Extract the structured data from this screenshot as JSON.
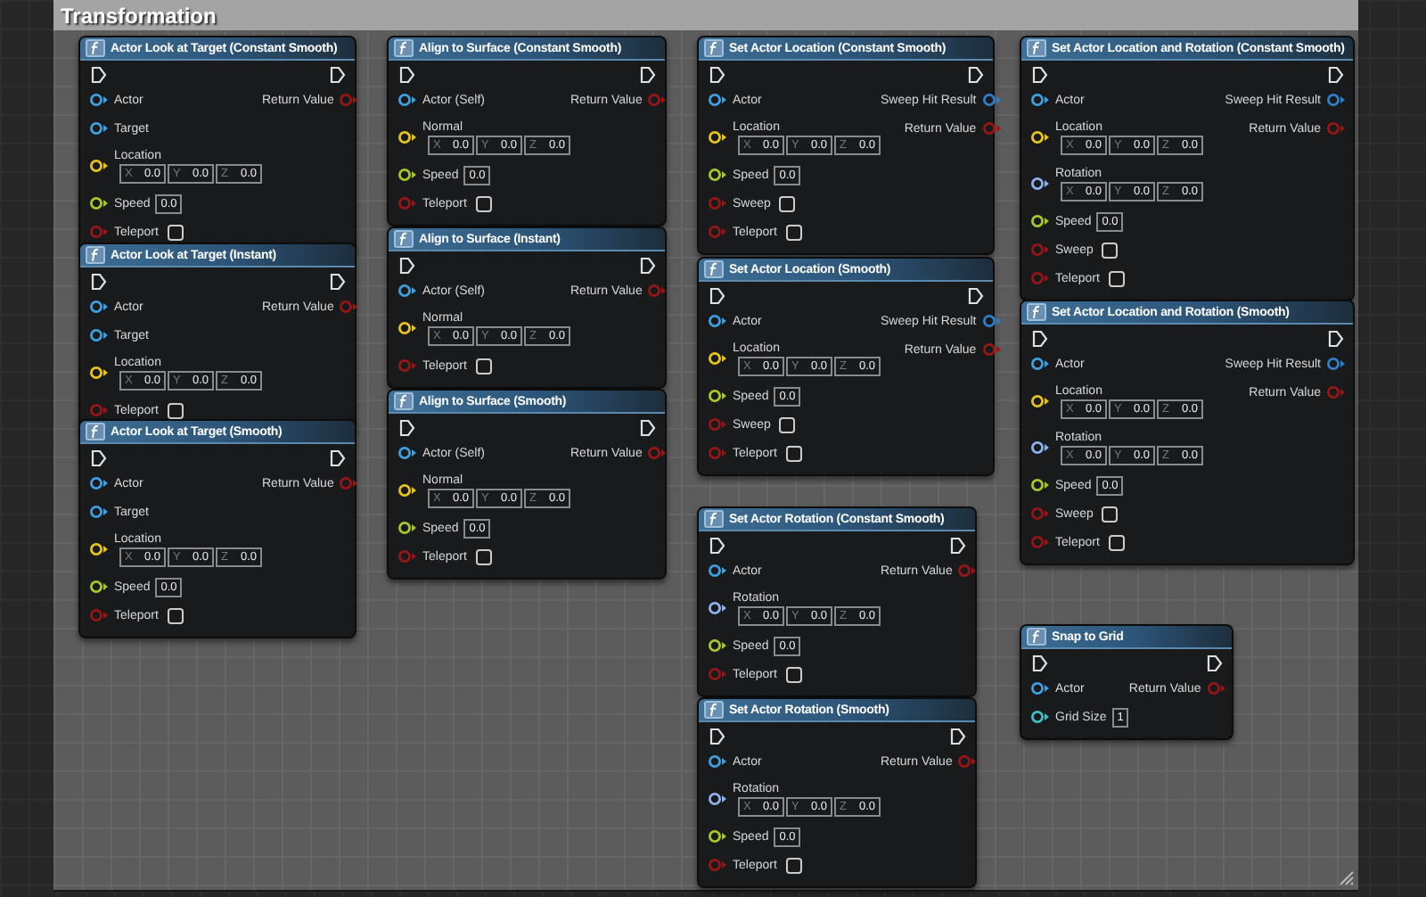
{
  "comment": {
    "title": "Transformation"
  },
  "nodes": [
    {
      "title": "Actor Look at Target (Constant Smooth)",
      "inputs": [
        {
          "kind": "object",
          "label": "Actor"
        },
        {
          "kind": "object",
          "label": "Target"
        },
        {
          "kind": "vector",
          "label": "Location",
          "components": [
            {
              "axis": "X",
              "value": "0.0"
            },
            {
              "axis": "Y",
              "value": "0.0"
            },
            {
              "axis": "Z",
              "value": "0.0"
            }
          ]
        },
        {
          "kind": "float",
          "label": "Speed",
          "value": "0.0"
        },
        {
          "kind": "bool",
          "label": "Teleport",
          "checked": false
        }
      ],
      "outputs": [
        {
          "kind": "bool",
          "label": "Return Value"
        }
      ]
    },
    {
      "title": "Actor Look at Target (Instant)",
      "inputs": [
        {
          "kind": "object",
          "label": "Actor"
        },
        {
          "kind": "object",
          "label": "Target"
        },
        {
          "kind": "vector",
          "label": "Location",
          "components": [
            {
              "axis": "X",
              "value": "0.0"
            },
            {
              "axis": "Y",
              "value": "0.0"
            },
            {
              "axis": "Z",
              "value": "0.0"
            }
          ]
        },
        {
          "kind": "bool",
          "label": "Teleport",
          "checked": false
        }
      ],
      "outputs": [
        {
          "kind": "bool",
          "label": "Return Value"
        }
      ]
    },
    {
      "title": "Actor Look at Target (Smooth)",
      "inputs": [
        {
          "kind": "object",
          "label": "Actor"
        },
        {
          "kind": "object",
          "label": "Target"
        },
        {
          "kind": "vector",
          "label": "Location",
          "components": [
            {
              "axis": "X",
              "value": "0.0"
            },
            {
              "axis": "Y",
              "value": "0.0"
            },
            {
              "axis": "Z",
              "value": "0.0"
            }
          ]
        },
        {
          "kind": "float",
          "label": "Speed",
          "value": "0.0"
        },
        {
          "kind": "bool",
          "label": "Teleport",
          "checked": false
        }
      ],
      "outputs": [
        {
          "kind": "bool",
          "label": "Return Value"
        }
      ]
    },
    {
      "title": "Align to Surface (Constant Smooth)",
      "inputs": [
        {
          "kind": "object",
          "label": "Actor (Self)"
        },
        {
          "kind": "vector",
          "label": "Normal",
          "components": [
            {
              "axis": "X",
              "value": "0.0"
            },
            {
              "axis": "Y",
              "value": "0.0"
            },
            {
              "axis": "Z",
              "value": "0.0"
            }
          ]
        },
        {
          "kind": "float",
          "label": "Speed",
          "value": "0.0"
        },
        {
          "kind": "bool",
          "label": "Teleport",
          "checked": false
        }
      ],
      "outputs": [
        {
          "kind": "bool",
          "label": "Return Value"
        }
      ]
    },
    {
      "title": "Align to Surface (Instant)",
      "inputs": [
        {
          "kind": "object",
          "label": "Actor (Self)"
        },
        {
          "kind": "vector",
          "label": "Normal",
          "components": [
            {
              "axis": "X",
              "value": "0.0"
            },
            {
              "axis": "Y",
              "value": "0.0"
            },
            {
              "axis": "Z",
              "value": "0.0"
            }
          ]
        },
        {
          "kind": "bool",
          "label": "Teleport",
          "checked": false
        }
      ],
      "outputs": [
        {
          "kind": "bool",
          "label": "Return Value"
        }
      ]
    },
    {
      "title": "Align to Surface (Smooth)",
      "inputs": [
        {
          "kind": "object",
          "label": "Actor (Self)"
        },
        {
          "kind": "vector",
          "label": "Normal",
          "components": [
            {
              "axis": "X",
              "value": "0.0"
            },
            {
              "axis": "Y",
              "value": "0.0"
            },
            {
              "axis": "Z",
              "value": "0.0"
            }
          ]
        },
        {
          "kind": "float",
          "label": "Speed",
          "value": "0.0"
        },
        {
          "kind": "bool",
          "label": "Teleport",
          "checked": false
        }
      ],
      "outputs": [
        {
          "kind": "bool",
          "label": "Return Value"
        }
      ]
    },
    {
      "title": "Set Actor Location (Constant Smooth)",
      "inputs": [
        {
          "kind": "object",
          "label": "Actor"
        },
        {
          "kind": "vector",
          "label": "Location",
          "components": [
            {
              "axis": "X",
              "value": "0.0"
            },
            {
              "axis": "Y",
              "value": "0.0"
            },
            {
              "axis": "Z",
              "value": "0.0"
            }
          ]
        },
        {
          "kind": "float",
          "label": "Speed",
          "value": "0.0"
        },
        {
          "kind": "bool",
          "label": "Sweep",
          "checked": false
        },
        {
          "kind": "bool",
          "label": "Teleport",
          "checked": false
        }
      ],
      "outputs": [
        {
          "kind": "struct",
          "label": "Sweep Hit Result"
        },
        {
          "kind": "bool",
          "label": "Return Value"
        }
      ]
    },
    {
      "title": "Set Actor Location (Smooth)",
      "inputs": [
        {
          "kind": "object",
          "label": "Actor"
        },
        {
          "kind": "vector",
          "label": "Location",
          "components": [
            {
              "axis": "X",
              "value": "0.0"
            },
            {
              "axis": "Y",
              "value": "0.0"
            },
            {
              "axis": "Z",
              "value": "0.0"
            }
          ]
        },
        {
          "kind": "float",
          "label": "Speed",
          "value": "0.0"
        },
        {
          "kind": "bool",
          "label": "Sweep",
          "checked": false
        },
        {
          "kind": "bool",
          "label": "Teleport",
          "checked": false
        }
      ],
      "outputs": [
        {
          "kind": "struct",
          "label": "Sweep Hit Result"
        },
        {
          "kind": "bool",
          "label": "Return Value"
        }
      ]
    },
    {
      "title": "Set Actor Rotation (Constant Smooth)",
      "inputs": [
        {
          "kind": "object",
          "label": "Actor"
        },
        {
          "kind": "rotator",
          "label": "Rotation",
          "components": [
            {
              "axis": "X",
              "value": "0.0"
            },
            {
              "axis": "Y",
              "value": "0.0"
            },
            {
              "axis": "Z",
              "value": "0.0"
            }
          ]
        },
        {
          "kind": "float",
          "label": "Speed",
          "value": "0.0"
        },
        {
          "kind": "bool",
          "label": "Teleport",
          "checked": false
        }
      ],
      "outputs": [
        {
          "kind": "bool",
          "label": "Return Value"
        }
      ]
    },
    {
      "title": "Set Actor Rotation (Smooth)",
      "inputs": [
        {
          "kind": "object",
          "label": "Actor"
        },
        {
          "kind": "rotator",
          "label": "Rotation",
          "components": [
            {
              "axis": "X",
              "value": "0.0"
            },
            {
              "axis": "Y",
              "value": "0.0"
            },
            {
              "axis": "Z",
              "value": "0.0"
            }
          ]
        },
        {
          "kind": "float",
          "label": "Speed",
          "value": "0.0"
        },
        {
          "kind": "bool",
          "label": "Teleport",
          "checked": false
        }
      ],
      "outputs": [
        {
          "kind": "bool",
          "label": "Return Value"
        }
      ]
    },
    {
      "title": "Set Actor Location and Rotation (Constant Smooth)",
      "inputs": [
        {
          "kind": "object",
          "label": "Actor"
        },
        {
          "kind": "vector",
          "label": "Location",
          "components": [
            {
              "axis": "X",
              "value": "0.0"
            },
            {
              "axis": "Y",
              "value": "0.0"
            },
            {
              "axis": "Z",
              "value": "0.0"
            }
          ]
        },
        {
          "kind": "rotator",
          "label": "Rotation",
          "components": [
            {
              "axis": "X",
              "value": "0.0"
            },
            {
              "axis": "Y",
              "value": "0.0"
            },
            {
              "axis": "Z",
              "value": "0.0"
            }
          ]
        },
        {
          "kind": "float",
          "label": "Speed",
          "value": "0.0"
        },
        {
          "kind": "bool",
          "label": "Sweep",
          "checked": false
        },
        {
          "kind": "bool",
          "label": "Teleport",
          "checked": false
        }
      ],
      "outputs": [
        {
          "kind": "struct",
          "label": "Sweep Hit Result"
        },
        {
          "kind": "bool",
          "label": "Return Value"
        }
      ]
    },
    {
      "title": "Set Actor Location and Rotation (Smooth)",
      "inputs": [
        {
          "kind": "object",
          "label": "Actor"
        },
        {
          "kind": "vector",
          "label": "Location",
          "components": [
            {
              "axis": "X",
              "value": "0.0"
            },
            {
              "axis": "Y",
              "value": "0.0"
            },
            {
              "axis": "Z",
              "value": "0.0"
            }
          ]
        },
        {
          "kind": "rotator",
          "label": "Rotation",
          "components": [
            {
              "axis": "X",
              "value": "0.0"
            },
            {
              "axis": "Y",
              "value": "0.0"
            },
            {
              "axis": "Z",
              "value": "0.0"
            }
          ]
        },
        {
          "kind": "float",
          "label": "Speed",
          "value": "0.0"
        },
        {
          "kind": "bool",
          "label": "Sweep",
          "checked": false
        },
        {
          "kind": "bool",
          "label": "Teleport",
          "checked": false
        }
      ],
      "outputs": [
        {
          "kind": "struct",
          "label": "Sweep Hit Result"
        },
        {
          "kind": "bool",
          "label": "Return Value"
        }
      ]
    },
    {
      "title": "Snap to Grid",
      "inputs": [
        {
          "kind": "object",
          "label": "Actor"
        },
        {
          "kind": "int",
          "label": "Grid Size",
          "value": "1"
        }
      ],
      "outputs": [
        {
          "kind": "bool",
          "label": "Return Value"
        }
      ]
    }
  ]
}
